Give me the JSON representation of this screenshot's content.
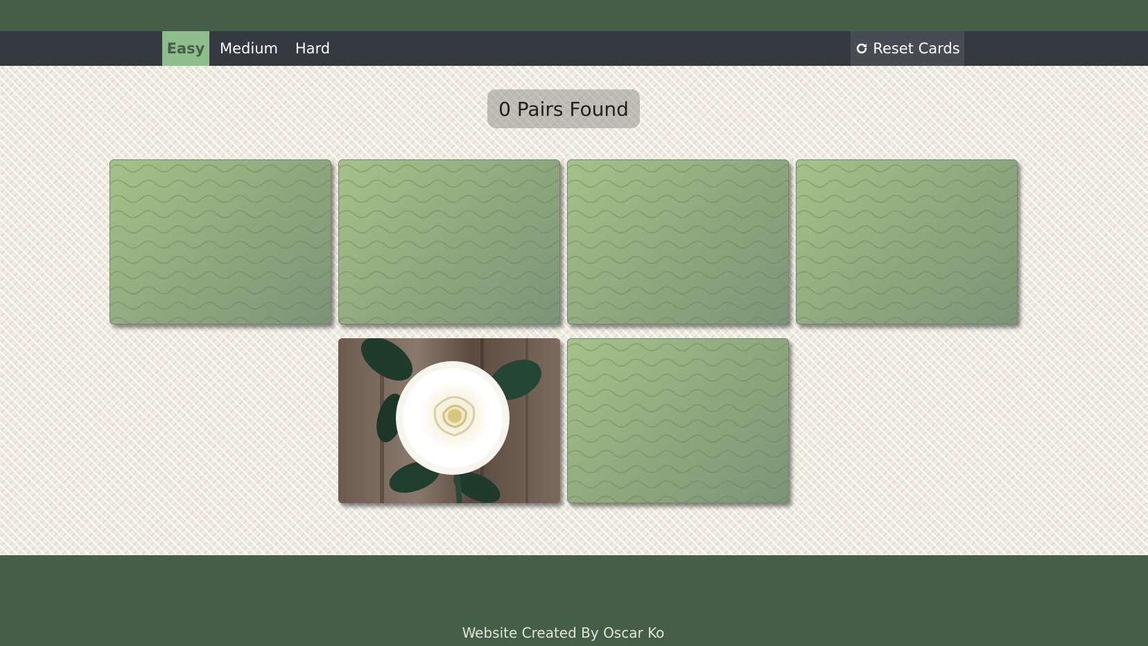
{
  "nav": {
    "levels": [
      {
        "label": "Easy",
        "active": true
      },
      {
        "label": "Medium",
        "active": false
      },
      {
        "label": "Hard",
        "active": false
      }
    ],
    "reset_label": "Reset Cards",
    "reset_icon": "refresh-icon"
  },
  "game": {
    "score_text": "0 Pairs Found",
    "cards": [
      {
        "state": "face-down"
      },
      {
        "state": "face-down"
      },
      {
        "state": "face-down"
      },
      {
        "state": "face-down"
      },
      {
        "state": "face-up",
        "image": "white-rose"
      },
      {
        "state": "face-down"
      }
    ]
  },
  "footer": {
    "credit": "Website Created By Oscar Ko"
  },
  "colors": {
    "brand_green": "#455e48",
    "active_tab": "#8fbe8e",
    "navbar": "#343a40",
    "card_back": "#93a87d"
  }
}
